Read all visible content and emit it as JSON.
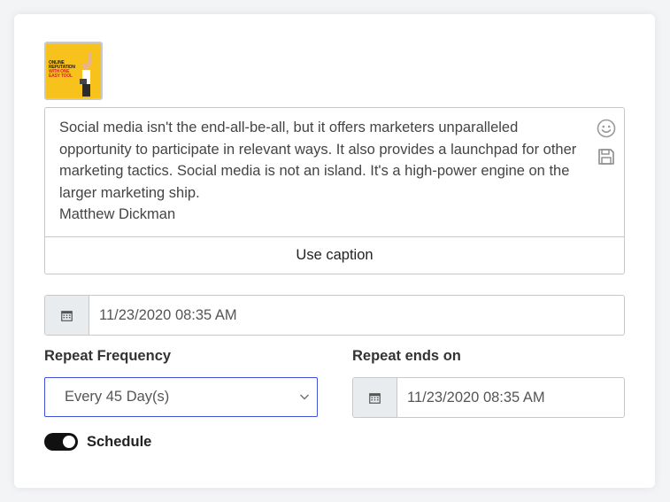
{
  "caption": {
    "text": "Social media isn't the end-all-be-all, but it offers marketers unparalleled opportunity to participate in relevant ways. It also provides a launchpad for other marketing tactics. Social media is not an island. It's a high-power engine on the larger marketing ship.\nMatthew Dickman",
    "emoji_icon": "smiley-icon",
    "save_icon": "floppy-disk-icon"
  },
  "thumbnail": {
    "line1": "ONLINE",
    "line2": "REPUTATION",
    "line3": "WITH ONE EASY TOOL"
  },
  "use_caption_label": "Use caption",
  "schedule_date": {
    "icon": "calendar-icon",
    "value": "11/23/2020 08:35 AM"
  },
  "repeat_frequency": {
    "label": "Repeat Frequency",
    "selected": "Every 45 Day(s)"
  },
  "repeat_ends": {
    "label": "Repeat ends on",
    "icon": "calendar-icon",
    "value": "11/23/2020 08:35 AM"
  },
  "schedule_toggle": {
    "label": "Schedule",
    "on": true
  },
  "colors": {
    "accent_border": "#3f51d6",
    "toggle_on": "#111111",
    "thumbnail_bg": "#f7c21b"
  }
}
